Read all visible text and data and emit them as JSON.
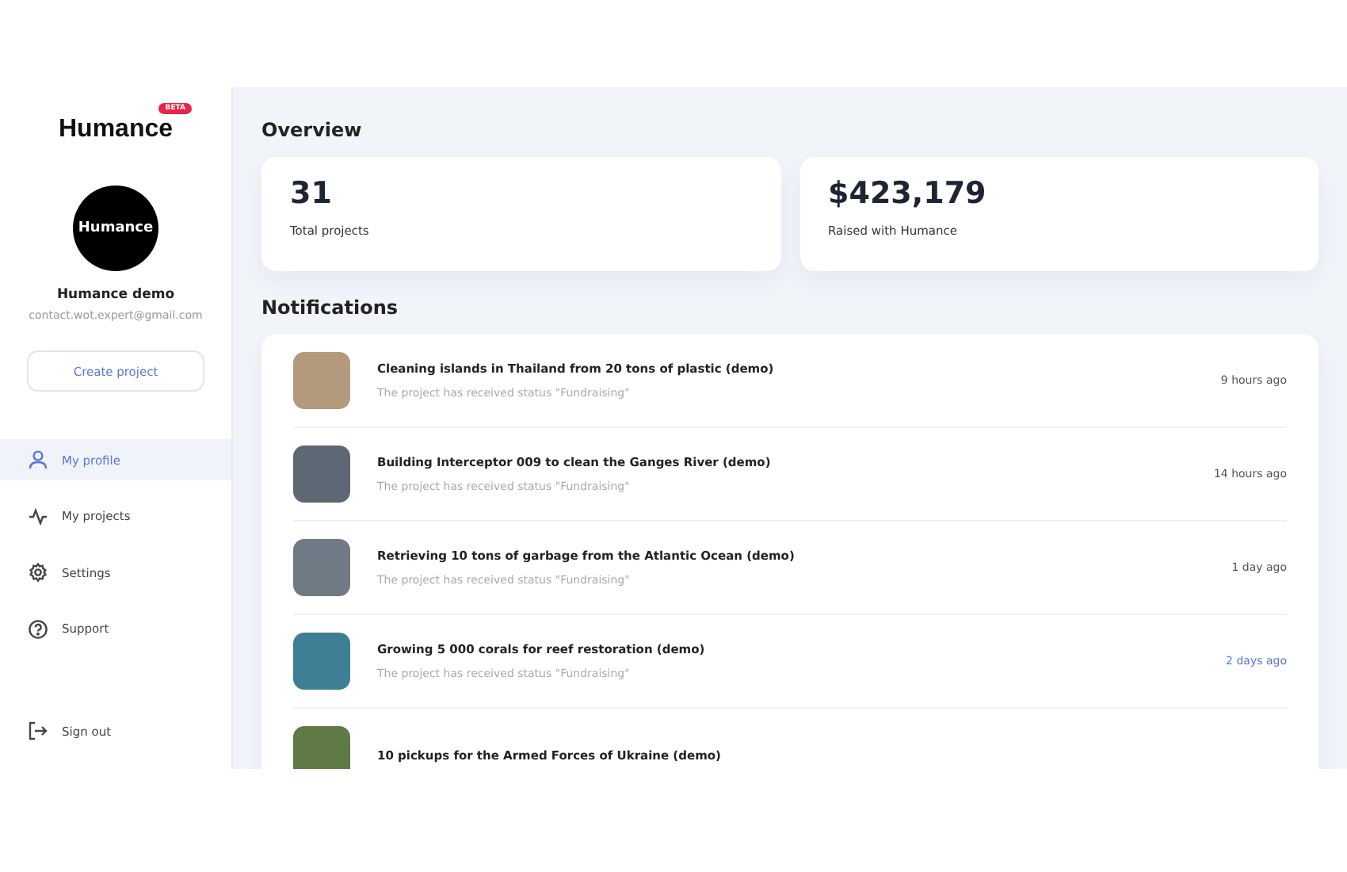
{
  "sidebar": {
    "logo": "Humance",
    "logo_badge": "BETA",
    "avatar_text": "Humance",
    "user_name": "Humance demo",
    "user_email": "contact.wot.expert@gmail.com",
    "create_button": "Create project",
    "nav": [
      {
        "label": "My profile",
        "kind": "profile",
        "selected": true
      },
      {
        "label": "My projects",
        "kind": "projects",
        "selected": false
      },
      {
        "label": "Settings",
        "kind": "settings",
        "selected": false
      },
      {
        "label": "Support",
        "kind": "support",
        "selected": false
      }
    ],
    "sign_out": "Sign out"
  },
  "overview": {
    "title": "Overview",
    "stats": [
      {
        "value": "31",
        "label": "Total projects"
      },
      {
        "value": "$423,179",
        "label": "Raised with Humance"
      }
    ]
  },
  "notifications": {
    "title": "Notifications",
    "items": [
      {
        "title": "Cleaning islands in Thailand from 20 tons of plastic (demo)",
        "status": "The project has received status \"Fundraising\"",
        "time": "9 hours ago",
        "highlighted": false
      },
      {
        "title": "Building Interceptor 009 to clean the Ganges River (demo)",
        "status": "The project has received status \"Fundraising\"",
        "time": "14 hours ago",
        "highlighted": false
      },
      {
        "title": "Retrieving 10 tons of garbage from the Atlantic Ocean (demo)",
        "status": "The project has received status \"Fundraising\"",
        "time": "1 day ago",
        "highlighted": false
      },
      {
        "title": "Growing 5 000 corals for reef restoration (demo)",
        "status": "The project has received status \"Fundraising\"",
        "time": "2 days ago",
        "highlighted": true
      },
      {
        "title": "10 pickups for the Armed Forces of Ukraine (demo)"
      }
    ]
  }
}
